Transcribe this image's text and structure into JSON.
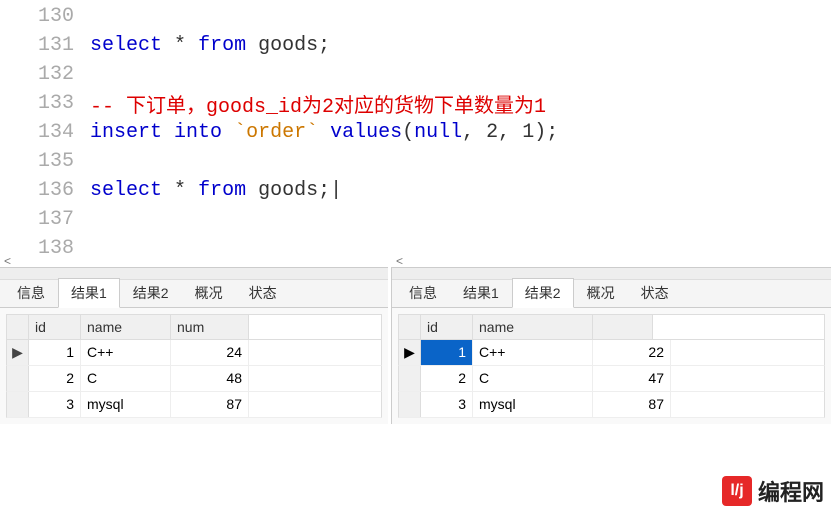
{
  "editor": {
    "lines": [
      {
        "num": "130",
        "tokens": []
      },
      {
        "num": "131",
        "tokens": [
          {
            "t": "select",
            "c": "kw"
          },
          {
            "t": " ",
            "c": ""
          },
          {
            "t": "*",
            "c": "punct"
          },
          {
            "t": " ",
            "c": ""
          },
          {
            "t": "from",
            "c": "kw"
          },
          {
            "t": " ",
            "c": ""
          },
          {
            "t": "goods",
            "c": "ident"
          },
          {
            "t": ";",
            "c": "punct"
          }
        ]
      },
      {
        "num": "132",
        "tokens": []
      },
      {
        "num": "133",
        "tokens": [
          {
            "t": "-- 下订单，goods_id为2对应的货物下单数量为1",
            "c": "comment"
          }
        ]
      },
      {
        "num": "134",
        "tokens": [
          {
            "t": "insert",
            "c": "kw"
          },
          {
            "t": " ",
            "c": ""
          },
          {
            "t": "into",
            "c": "kw"
          },
          {
            "t": " ",
            "c": ""
          },
          {
            "t": "`order`",
            "c": "str-id"
          },
          {
            "t": " ",
            "c": ""
          },
          {
            "t": "values",
            "c": "kw"
          },
          {
            "t": "(",
            "c": "punct"
          },
          {
            "t": "null",
            "c": "null"
          },
          {
            "t": ", ",
            "c": "punct"
          },
          {
            "t": "2",
            "c": "num"
          },
          {
            "t": ", ",
            "c": "punct"
          },
          {
            "t": "1",
            "c": "num"
          },
          {
            "t": ");",
            "c": "punct"
          }
        ]
      },
      {
        "num": "135",
        "tokens": []
      },
      {
        "num": "136",
        "tokens": [
          {
            "t": "select",
            "c": "kw"
          },
          {
            "t": " ",
            "c": ""
          },
          {
            "t": "*",
            "c": "punct"
          },
          {
            "t": " ",
            "c": ""
          },
          {
            "t": "from",
            "c": "kw"
          },
          {
            "t": " ",
            "c": ""
          },
          {
            "t": "goods",
            "c": "ident"
          },
          {
            "t": ";",
            "c": "punct"
          },
          {
            "t": "|",
            "c": "cursor"
          }
        ]
      },
      {
        "num": "137",
        "tokens": []
      },
      {
        "num": "138",
        "tokens": []
      }
    ]
  },
  "panel1": {
    "tabs": {
      "info": "信息",
      "r1": "结果1",
      "r2": "结果2",
      "profile": "概况",
      "status": "状态",
      "active": "r1"
    },
    "columns": {
      "id": "id",
      "name": "name",
      "num": "num"
    },
    "rows": [
      {
        "id": "1",
        "name": "C++",
        "num": "24",
        "current": true
      },
      {
        "id": "2",
        "name": "C",
        "num": "48"
      },
      {
        "id": "3",
        "name": "mysql",
        "num": "87"
      }
    ]
  },
  "panel2": {
    "tabs": {
      "info": "信息",
      "r1": "结果1",
      "r2": "结果2",
      "profile": "概况",
      "status": "状态",
      "active": "r2"
    },
    "columns": {
      "id": "id",
      "name": "name",
      "num": ""
    },
    "rows": [
      {
        "id": "1",
        "name": "C++",
        "num": "22",
        "current": true,
        "highlight": true
      },
      {
        "id": "2",
        "name": "C",
        "num": "47"
      },
      {
        "id": "3",
        "name": "mysql",
        "num": "87"
      }
    ]
  },
  "watermark": {
    "logo": "l/j",
    "text": "编程网"
  }
}
